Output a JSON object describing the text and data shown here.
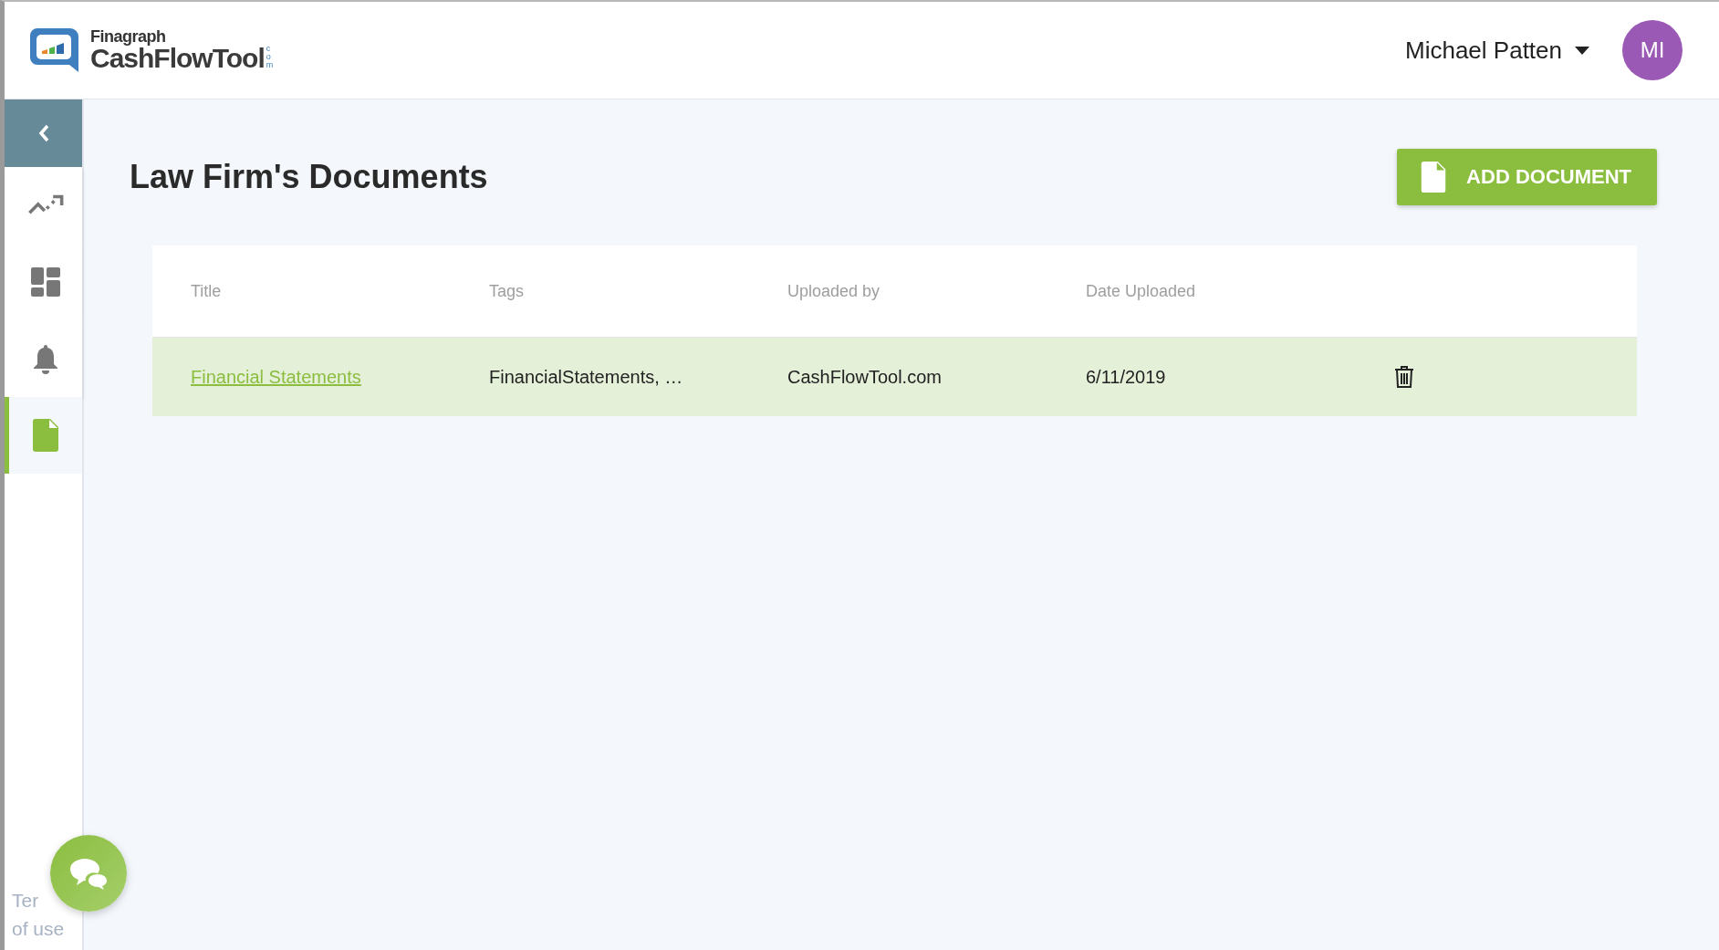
{
  "logo": {
    "brand": "Finagraph",
    "product": "CashFlowTool",
    "suffix": "com"
  },
  "user": {
    "name": "Michael Patten",
    "initials": "MI"
  },
  "sidebar": {
    "items": [
      {
        "kind": "trend",
        "selected": false
      },
      {
        "kind": "dashboard",
        "selected": false
      },
      {
        "kind": "alerts",
        "selected": false
      },
      {
        "kind": "documents",
        "selected": true
      }
    ],
    "footer_lines": [
      "Ter",
      "of use"
    ]
  },
  "page": {
    "title": "Law Firm's Documents",
    "add_button": "ADD DOCUMENT"
  },
  "table": {
    "columns": [
      "Title",
      "Tags",
      "Uploaded by",
      "Date Uploaded"
    ],
    "rows": [
      {
        "title": "Financial Statements",
        "tags": "FinancialStatements, …",
        "uploaded_by": "CashFlowTool.com",
        "date_uploaded": "6/11/2019",
        "selected": true
      }
    ]
  }
}
